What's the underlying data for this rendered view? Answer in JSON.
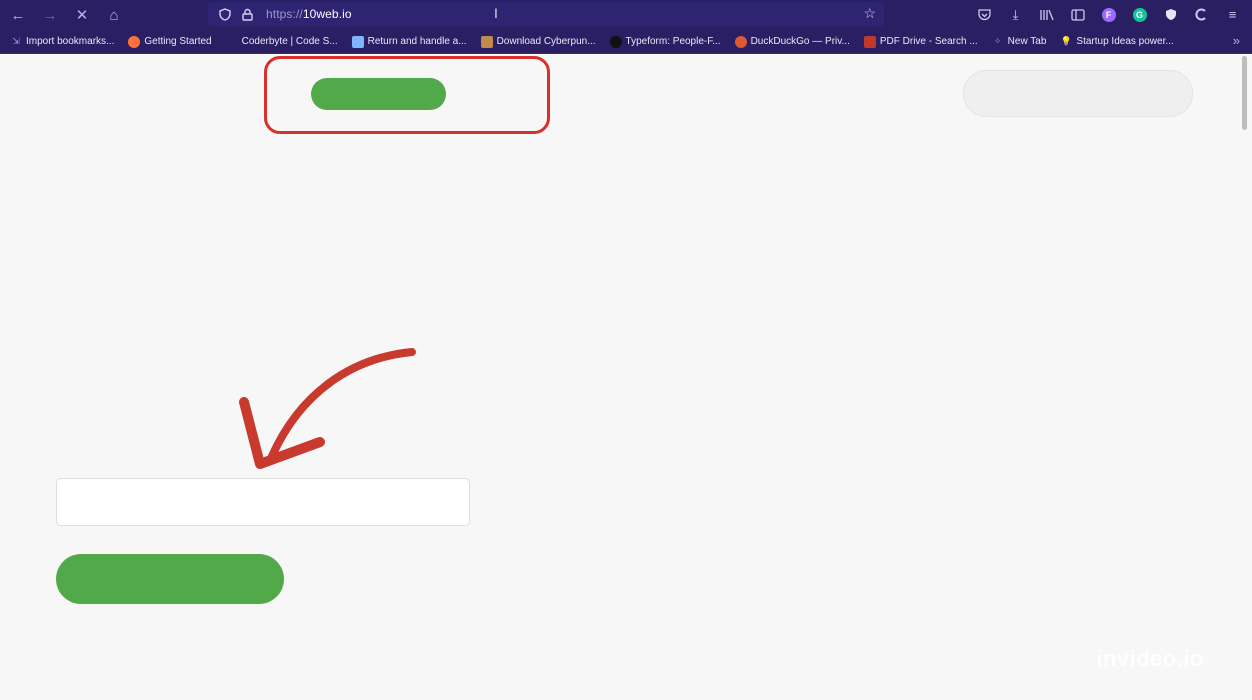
{
  "browser": {
    "url_scheme": "https://",
    "url_host": "10web.io",
    "bookmarks": [
      {
        "label": "Import bookmarks...",
        "icon": "import-icon",
        "color": "#9aa0ff"
      },
      {
        "label": "Getting Started",
        "icon": "firefox-icon",
        "color": "#ff7139"
      },
      {
        "label": "Coderbyte | Code S...",
        "icon": "coderbyte-icon",
        "color": "#2a1f63"
      },
      {
        "label": "Return and handle a...",
        "icon": "doc-icon",
        "color": "#7fb5ff"
      },
      {
        "label": "Download Cyberpun...",
        "icon": "image-icon",
        "color": "#c08a4a"
      },
      {
        "label": "Typeform: People-F...",
        "icon": "typeform-icon",
        "color": "#111111"
      },
      {
        "label": "DuckDuckGo — Priv...",
        "icon": "duckduckgo-icon",
        "color": "#de5833"
      },
      {
        "label": "PDF Drive - Search ...",
        "icon": "pdf-icon",
        "color": "#c0392b"
      },
      {
        "label": "New Tab",
        "icon": "newtab-icon",
        "color": "#8a8fd9"
      },
      {
        "label": "Startup Ideas power...",
        "icon": "bulb-icon",
        "color": "#f5c542"
      }
    ]
  },
  "watermark": "invideo.io",
  "colors": {
    "accent_green": "#52a94a",
    "highlight_red": "#d6322b",
    "chrome_purple": "#2a1f63"
  }
}
